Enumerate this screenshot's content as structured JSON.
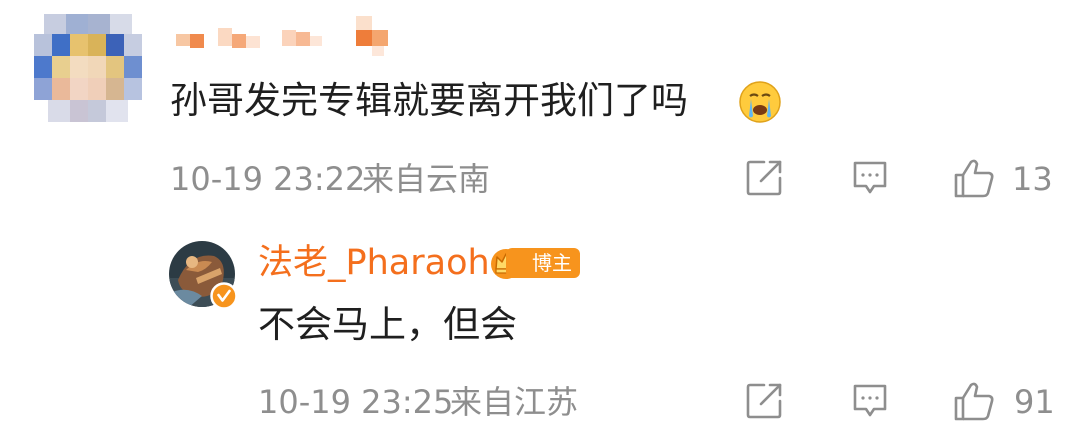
{
  "comment": {
    "text": "孙哥发完专辑就要离开我们了吗",
    "emoji": "crying-face-icon",
    "time": "10-19 23:22",
    "location": "来自云南",
    "like_count": "13"
  },
  "reply": {
    "username": "法老_Pharaoh",
    "badge": "博主",
    "text": "不会马上，但会",
    "time": "10-19 23:25",
    "location": "来自江苏",
    "like_count": "91"
  },
  "colors": {
    "username": "#f46f1d",
    "badge": "#f7941d",
    "meta": "#8e8e8e"
  }
}
